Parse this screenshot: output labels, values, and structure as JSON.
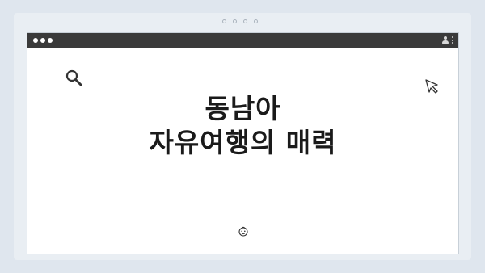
{
  "headline": {
    "line1": "동남아",
    "line2": "자유여행의 매력"
  },
  "icons": {
    "search": "search-icon",
    "cursor": "cursor-icon",
    "face": "face-icon",
    "profile": "profile-icon",
    "menu": "kebab-menu-icon"
  }
}
